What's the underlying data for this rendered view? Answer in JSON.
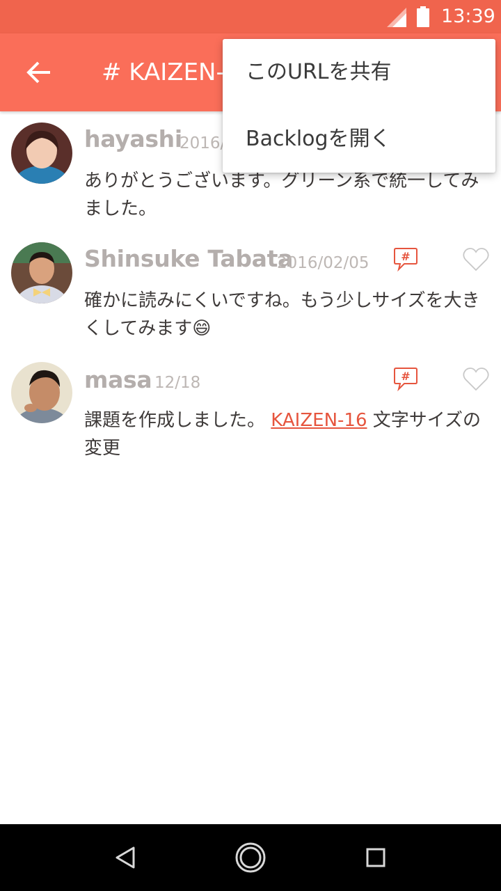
{
  "status_bar": {
    "time": "13:39"
  },
  "app_bar": {
    "title": "# KAIZEN-"
  },
  "menu": {
    "items": [
      {
        "label": "このURLを共有"
      },
      {
        "label": "Backlogを開く"
      }
    ]
  },
  "comments": [
    {
      "author": "hayashi",
      "date": "2016/",
      "text": "ありがとうございます。グリーン系で統一してみました。"
    },
    {
      "author": "Shinsuke Tabata",
      "date": "2016/02/05",
      "text": "確かに読みにくいですね。もう少しサイズを大きくしてみます😄"
    },
    {
      "author": "masa",
      "date": "12/18",
      "text_before": "課題を作成しました。",
      "link": "KAIZEN-16",
      "text_after": " 文字サイズの変更"
    }
  ],
  "icons": {
    "back": "arrow-left-icon",
    "issue_link": "hash-speech-bubble-icon",
    "like": "heart-outline-icon"
  },
  "colors": {
    "status_bar": "#f0644d",
    "app_bar": "#fa6e59",
    "accent": "#e6553e"
  }
}
